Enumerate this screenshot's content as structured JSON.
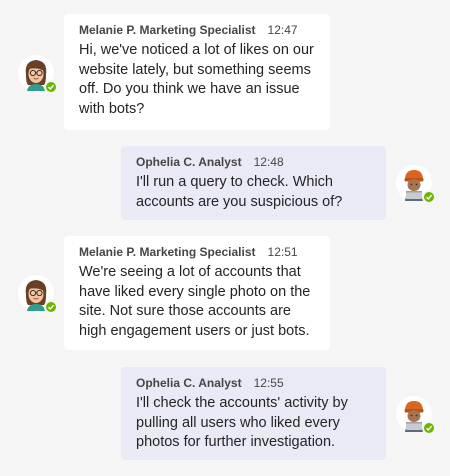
{
  "messages": [
    {
      "sender": "Melanie P. Marketing Specialist",
      "time": "12:47",
      "text": "Hi, we've noticed a lot of likes on our website lately, but something seems off. Do you think we have an issue with bots?",
      "side": "left",
      "avatar_icon": "woman-glasses-avatar-icon",
      "status": "available"
    },
    {
      "sender": "Ophelia C. Analyst",
      "time": "12:48",
      "text": "I'll run a query to check. Which accounts are you suspicious of?",
      "side": "right",
      "avatar_icon": "woman-beanie-laptop-avatar-icon",
      "status": "available"
    },
    {
      "sender": "Melanie P. Marketing Specialist",
      "time": "12:51",
      "text": "We're seeing a lot of accounts that have liked every single photo on the site. Not sure those accounts are high engagement users or just bots.",
      "side": "left",
      "avatar_icon": "woman-glasses-avatar-icon",
      "status": "available"
    },
    {
      "sender": "Ophelia C. Analyst",
      "time": "12:55",
      "text": "I'll check the accounts' activity by pulling all users who liked every photos for further investigation.",
      "side": "right",
      "avatar_icon": "woman-beanie-laptop-avatar-icon",
      "status": "available"
    }
  ],
  "colors": {
    "background": "#f5f5f5",
    "other_bubble": "#ffffff",
    "self_bubble": "#e9eaf6",
    "presence_available": "#6bb700"
  }
}
